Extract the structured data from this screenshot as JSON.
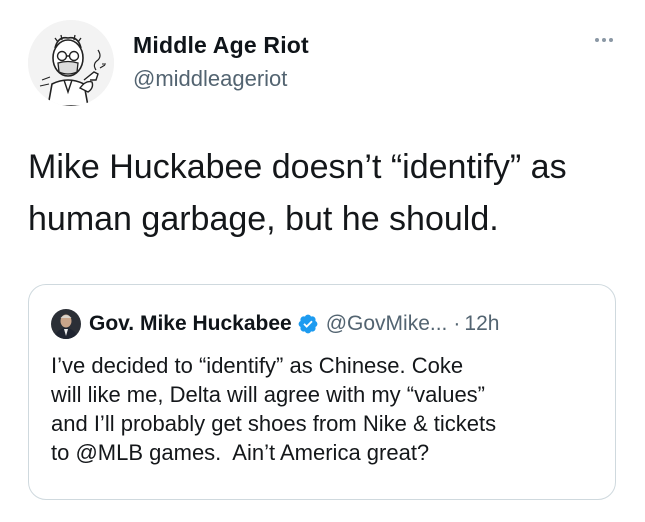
{
  "author": {
    "display_name": "Middle Age Riot",
    "handle": "@middleageriot",
    "avatar_icon": "man-with-pipe-cartoon-icon"
  },
  "menu": {
    "more_icon": "more-horizontal-icon"
  },
  "tweet": {
    "text": "Mike Huckabee doesn’t “identify” as\nhuman garbage, but he should."
  },
  "quoted_tweet": {
    "display_name": "Gov. Mike Huckabee",
    "verified_icon": "verified-badge-icon",
    "handle": "@GovMike...",
    "separator": "·",
    "time": "12h",
    "text": "I’ve decided to “identify” as Chinese. Coke\nwill like me, Delta will agree with my “values”\nand I’ll probably get shoes from Nike & tickets\nto @MLB games.  Ain’t America great?"
  },
  "colors": {
    "text_primary": "#0f1419",
    "text_secondary": "#536471",
    "verified_blue": "#1d9bf0",
    "card_border": "#cfd9de"
  }
}
